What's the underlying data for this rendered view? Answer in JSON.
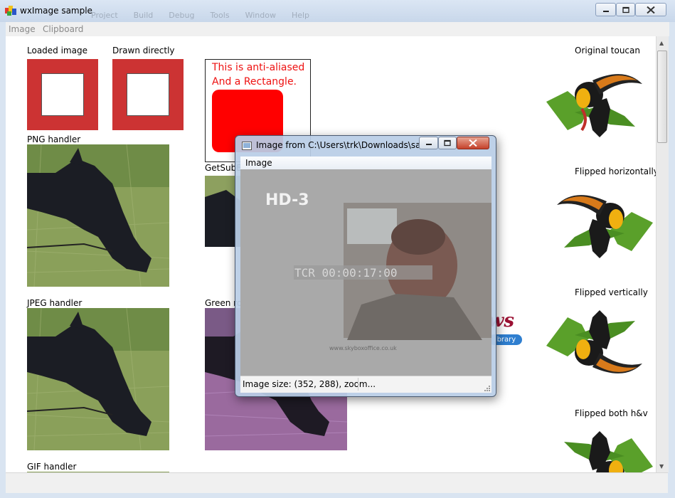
{
  "window": {
    "title": "wxImage sample",
    "ghost_menu": [
      "Project",
      "Build",
      "Debug",
      "Tools",
      "Window",
      "Help"
    ]
  },
  "menubar": {
    "items": [
      "Image",
      "Clipboard"
    ]
  },
  "content": {
    "loaded_image_label": "Loaded image",
    "drawn_directly_label": "Drawn directly",
    "aa_line1": "This is anti-aliased",
    "aa_line2": "And a Rectangle.",
    "png_label": "PNG handler",
    "getsub_label": "GetSubB",
    "jpeg_label": "JPEG handler",
    "green_label": "Green ro",
    "gif_label": "GIF handler",
    "news_text": "ws",
    "library_text": "ibrary",
    "toucan_labels": [
      "Original toucan",
      "Flipped horizontally",
      "Flipped vertically",
      "Flipped both h&v"
    ]
  },
  "child_window": {
    "title": "Image from C:\\Users\\trk\\Downloads\\sam...",
    "menu": "Image",
    "status": "Image size: (352, 288), zoom...",
    "video_text": {
      "channel": "HD-3",
      "tcr": "TCR  00:00:17:00",
      "url": "www.skyboxoffice.co.uk"
    }
  },
  "colors": {
    "accent_red": "#cc3333",
    "aa_text": "#ee1111",
    "title_bar": "#c8d7ea",
    "close_red": "#c5412a"
  },
  "icons": [
    "app-icon",
    "minimize-icon",
    "maximize-icon",
    "close-icon",
    "child-app-icon",
    "resize-grip-icon"
  ]
}
